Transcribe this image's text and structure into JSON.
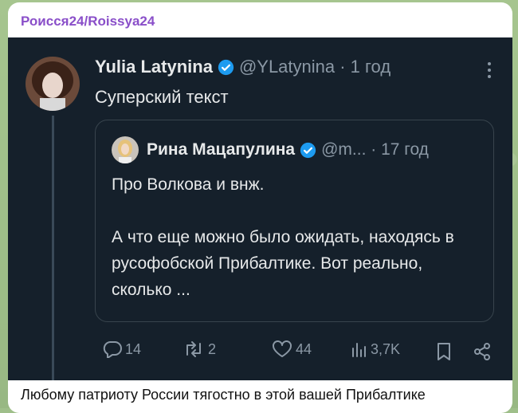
{
  "post": {
    "channel_name": "Роисся24/Roissya24",
    "caption": "Любому патриоту России тягостно в этой вашей Прибалтике"
  },
  "tweet": {
    "author_name": "Yulia Latynina",
    "handle_time": "@YLatynina · 1 год",
    "text": "Суперский текст",
    "quote": {
      "author_name": "Рина Мацапулина",
      "handle_time": "@m... · 17 год",
      "paragraph1": "Про Волкова и внж.",
      "paragraph2": "А что еще можно было ожидать, находясь в русофобской Прибалтике. Вот реально, сколько ..."
    },
    "actions": {
      "replies": "14",
      "retweets": "2",
      "likes": "44",
      "views": "3,7K"
    }
  },
  "colors": {
    "tweet_bg": "#15202b",
    "verified": "#1d9bf0",
    "channel_name": "#8a4fc9"
  }
}
